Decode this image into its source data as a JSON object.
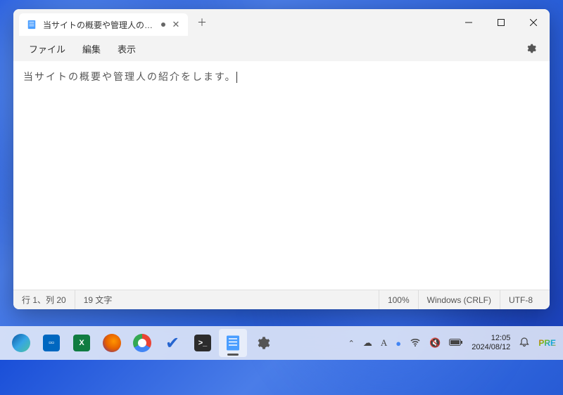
{
  "tab": {
    "title": "当サイトの概要や管理人の紹介をします。"
  },
  "menu": {
    "file": "ファイル",
    "edit": "編集",
    "view": "表示"
  },
  "editor": {
    "content": "当サイトの概要や管理人の紹介をします。"
  },
  "status": {
    "position": "行 1、列 20",
    "chars": "19 文字",
    "zoom": "100%",
    "eol": "Windows (CRLF)",
    "encoding": "UTF-8"
  },
  "clock": {
    "time": "12:05",
    "date": "2024/08/12"
  }
}
